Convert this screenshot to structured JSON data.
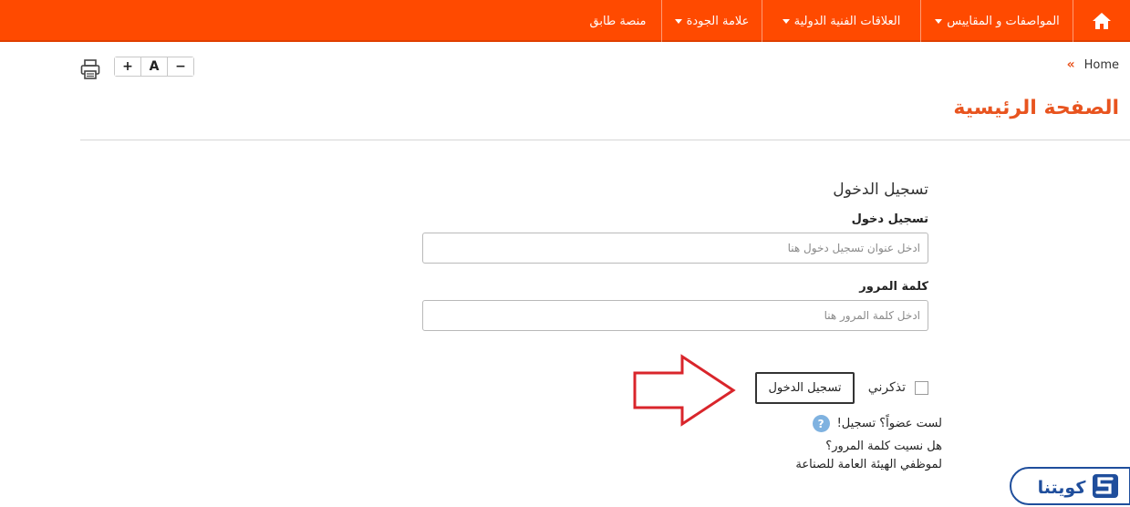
{
  "nav": {
    "items": [
      {
        "label": "المواصفات و المقاييس",
        "dropdown": true
      },
      {
        "label": "العلاقات الفنية الدولية",
        "dropdown": true
      },
      {
        "label": "علامة الجودة",
        "dropdown": true
      },
      {
        "label": "منصة طابق",
        "dropdown": false
      }
    ],
    "home_icon": "home-icon",
    "background": "#ff4a00"
  },
  "breadcrumb": {
    "home": "Home",
    "separator": "«"
  },
  "toolbar": {
    "print_icon": "printer-icon",
    "font_increase": "+",
    "font_reset": "A",
    "font_decrease": "−"
  },
  "page": {
    "title": "الصفحة الرئيسية",
    "title_color": "#e8541f"
  },
  "form": {
    "heading": "تسجيل الدخول",
    "username_label": "تسجيل دخول",
    "username_placeholder": "ادخل عنوان تسجيل دخول هنا",
    "password_label": "كلمة المرور",
    "password_placeholder": "ادخل كلمة المرور هنا",
    "remember_label": "تذكرني",
    "submit_label": "تسجيل الدخول"
  },
  "links": {
    "register": "لست عضواً؟ تسجيل!",
    "forgot": "هل نسيت كلمة المرور؟",
    "employees": "لموظفي الهيئة العامة للصناعة"
  },
  "logo": {
    "text": "كويتنا"
  }
}
